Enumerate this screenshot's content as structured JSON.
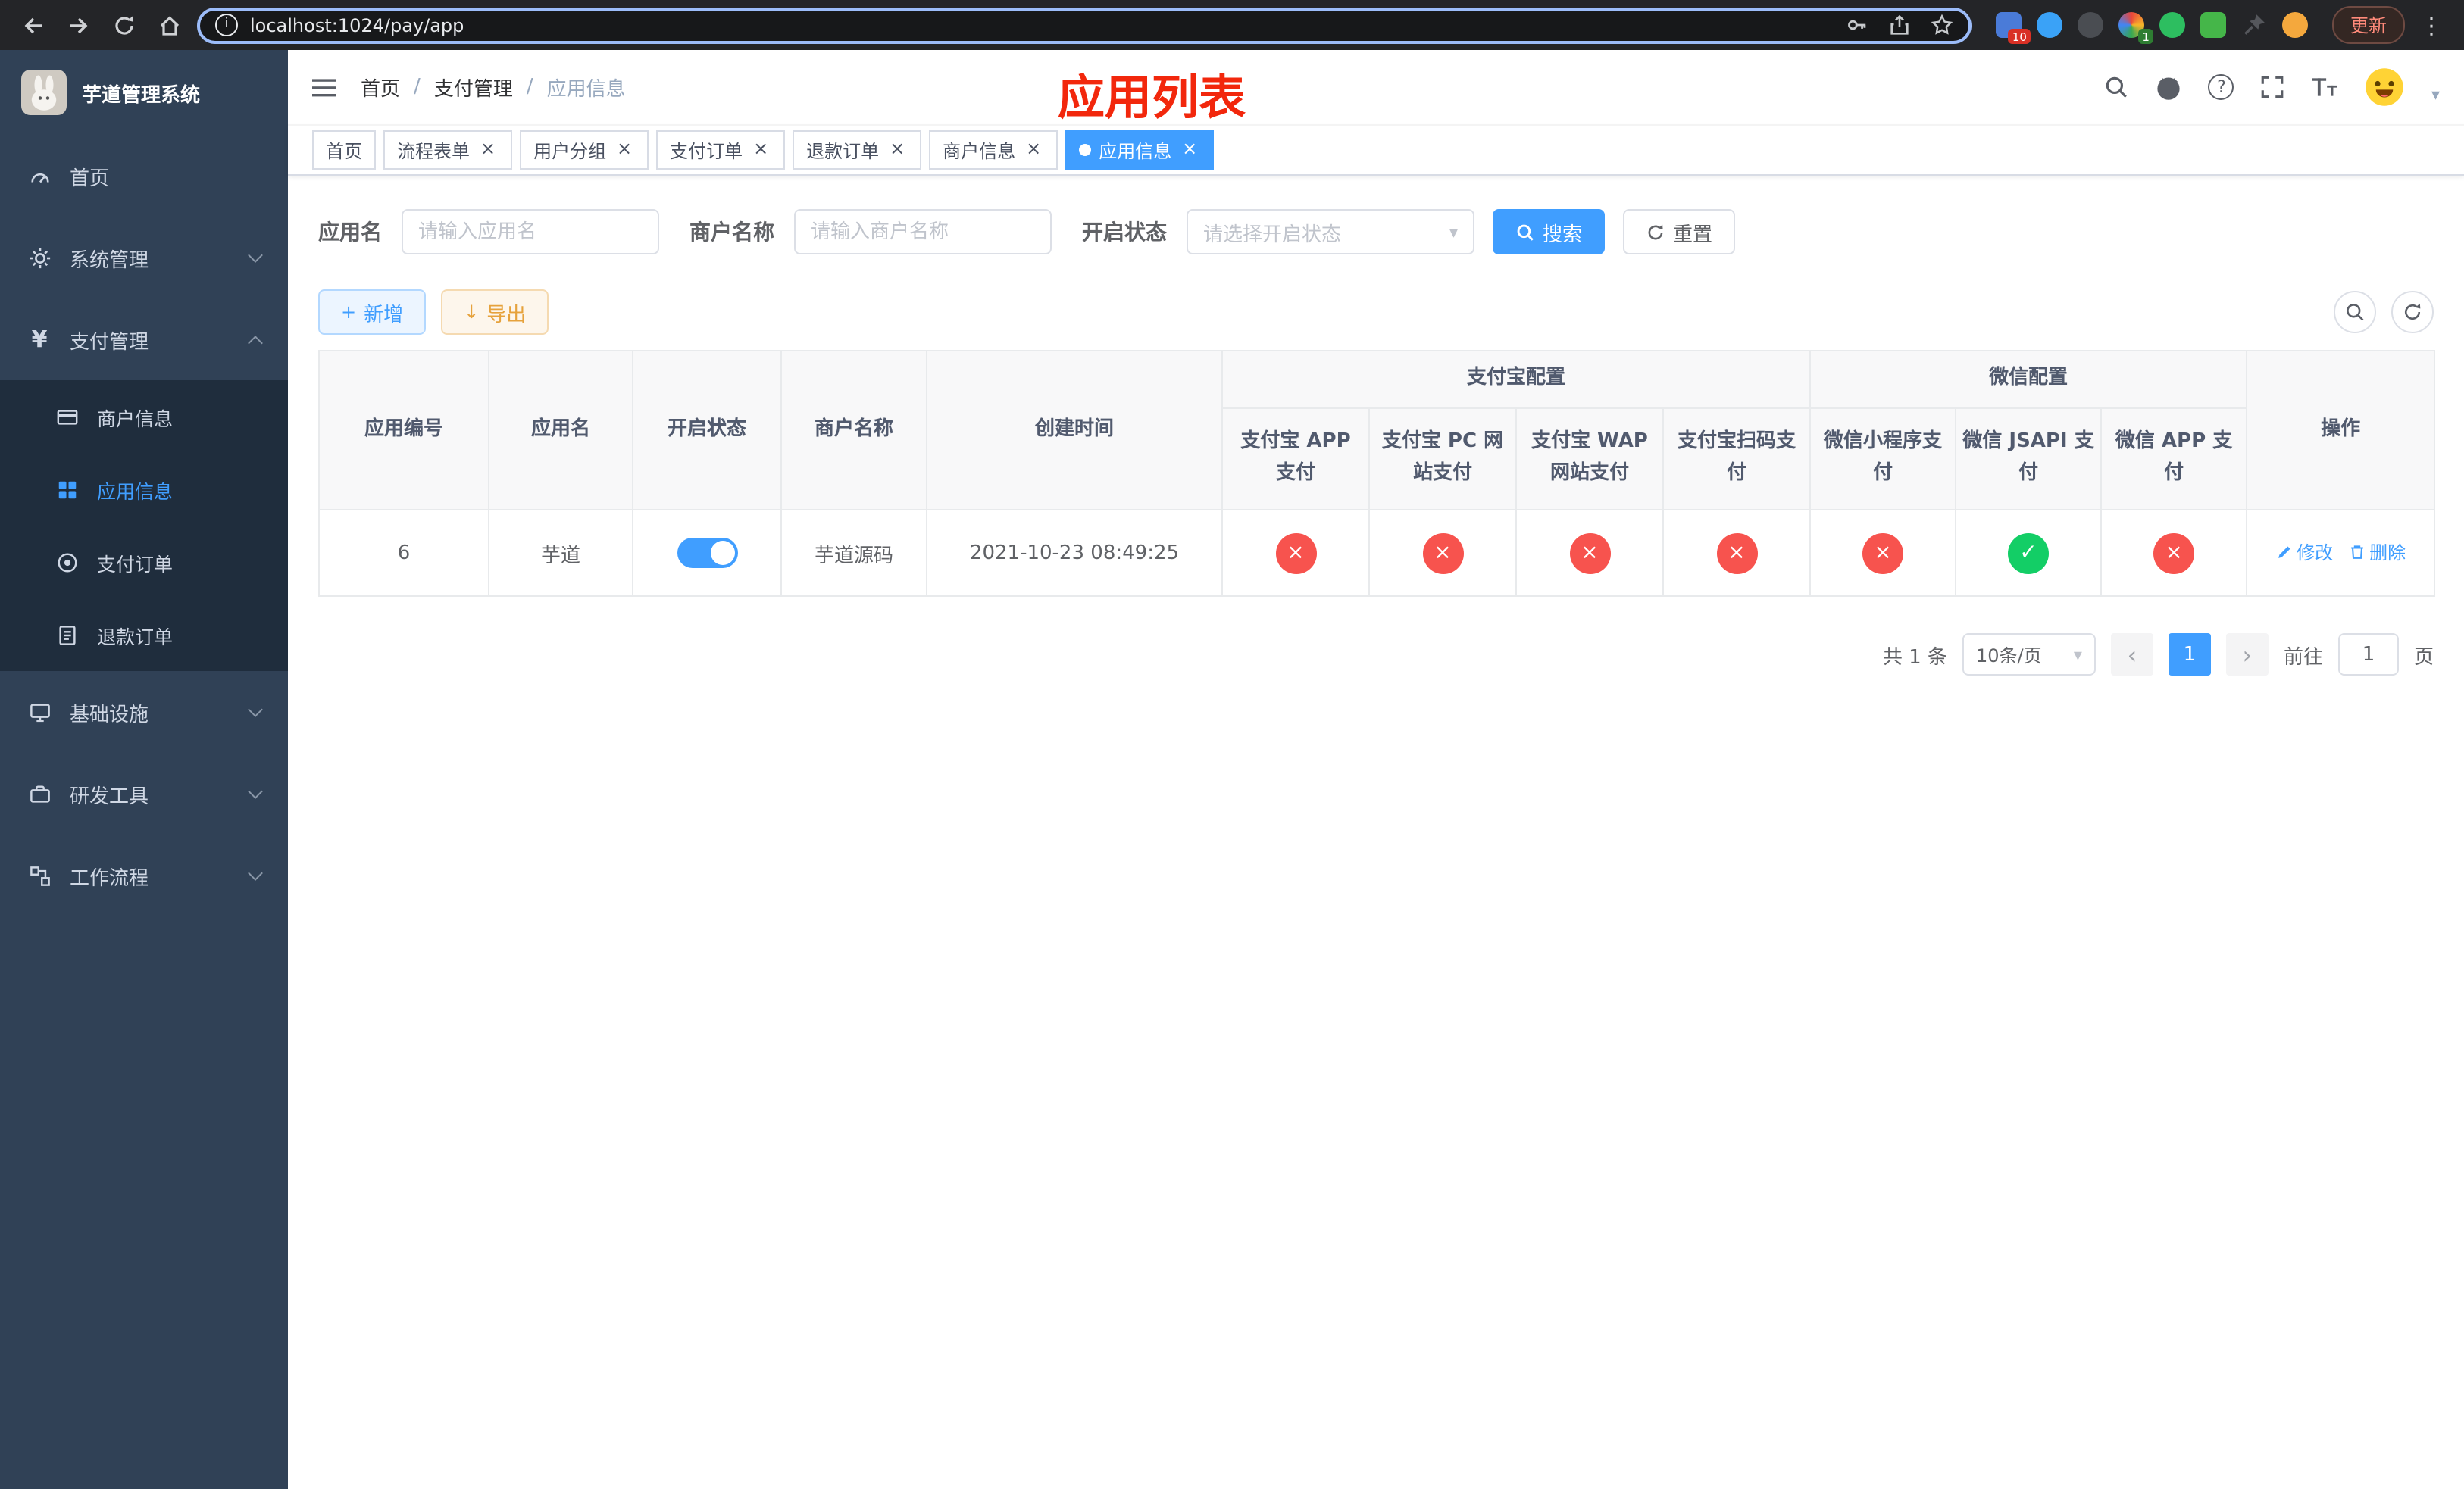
{
  "icons": {
    "close": "×",
    "check": "✓",
    "cross": "×",
    "caret_down": "▾",
    "chevron_left": "‹",
    "chevron_right": "›",
    "plus": "+",
    "download": "↓",
    "menu_dots": "⋮",
    "question": "?",
    "info": "i",
    "yen": "¥",
    "breadcrumb_separator": "/"
  },
  "browser": {
    "url": "localhost:1024/pay/app",
    "update_label": "更新",
    "extension_badge_blue": "10",
    "extension_badge_green": "1"
  },
  "annotation": "应用列表",
  "sidebar": {
    "logo_title": "芋道管理系统",
    "home": "首页",
    "system": "系统管理",
    "payment": "支付管理",
    "merchant_info": "商户信息",
    "app_info": "应用信息",
    "pay_order": "支付订单",
    "refund_order": "退款订单",
    "infrastructure": "基础设施",
    "dev_tools": "研发工具",
    "workflow": "工作流程"
  },
  "header": {
    "breadcrumb": [
      "首页",
      "支付管理",
      "应用信息"
    ]
  },
  "tabs": [
    {
      "label": "首页",
      "closable": false,
      "active": false
    },
    {
      "label": "流程表单",
      "closable": true,
      "active": false
    },
    {
      "label": "用户分组",
      "closable": true,
      "active": false
    },
    {
      "label": "支付订单",
      "closable": true,
      "active": false
    },
    {
      "label": "退款订单",
      "closable": true,
      "active": false
    },
    {
      "label": "商户信息",
      "closable": true,
      "active": false
    },
    {
      "label": "应用信息",
      "closable": true,
      "active": true
    }
  ],
  "filters": {
    "app_name_label": "应用名",
    "app_name_placeholder": "请输入应用名",
    "merchant_label": "商户名称",
    "merchant_placeholder": "请输入商户名称",
    "status_label": "开启状态",
    "status_placeholder": "请选择开启状态",
    "search_label": "搜索",
    "reset_label": "重置"
  },
  "toolbar": {
    "add_label": "新增",
    "export_label": "导出"
  },
  "table": {
    "headers": {
      "app_id": "应用编号",
      "app_name": "应用名",
      "status": "开启状态",
      "merchant": "商户名称",
      "created": "创建时间",
      "alipay_group": "支付宝配置",
      "wechat_group": "微信配置",
      "alipay_app": "支付宝 APP 支付",
      "alipay_pc": "支付宝 PC 网站支付",
      "alipay_wap": "支付宝 WAP 网站支付",
      "alipay_qr": "支付宝扫码支付",
      "wx_mini": "微信小程序支付",
      "wx_jsapi": "微信 JSAPI 支付",
      "wx_app": "微信 APP 支付",
      "ops": "操作"
    },
    "rows": [
      {
        "id": "6",
        "name": "芋道",
        "enabled": true,
        "merchant": "芋道源码",
        "created": "2021-10-23 08:49:25",
        "alipay_app": false,
        "alipay_pc": false,
        "alipay_wap": false,
        "alipay_qr": false,
        "wx_mini": false,
        "wx_jsapi": true,
        "wx_app": false,
        "edit_label": "修改",
        "delete_label": "删除"
      }
    ]
  },
  "pagination": {
    "total_label": "共 1 条",
    "page_size_label": "10条/页",
    "current_page": "1",
    "goto_label": "前往",
    "goto_value": "1",
    "page_unit": "页"
  },
  "colors": {
    "accent": "#409eff",
    "success": "#13ce66",
    "danger": "#f7534e",
    "annotation": "#f2270c",
    "sidebar_bg": "#304156",
    "submenu_bg": "#1f2d3d"
  }
}
